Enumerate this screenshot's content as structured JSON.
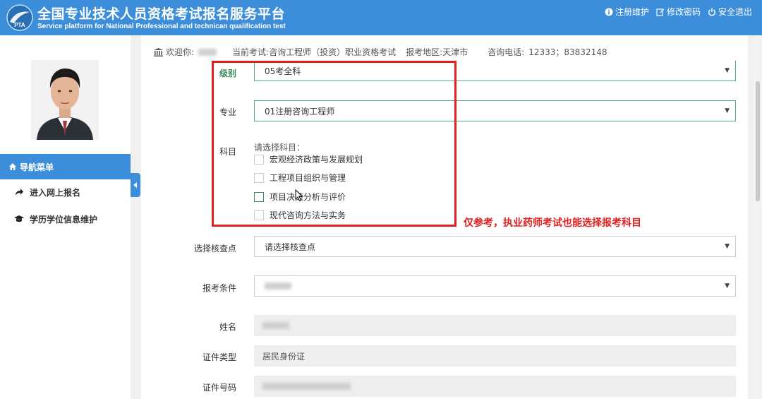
{
  "header": {
    "title": "全国专业技术人员资格考试报名服务平台",
    "subtitle": "Service platform for National Professional and technican qualification test",
    "logo_text": "PTA",
    "links": [
      "注册维护",
      "修改密码",
      "安全退出"
    ]
  },
  "sidebar": {
    "nav_title": "导航菜单",
    "items": [
      "进入网上报名",
      "学历学位信息维护"
    ]
  },
  "info_bar": {
    "welcome_label": "欢迎你:",
    "exam_label": "当前考试:",
    "exam_value": "咨询工程师（投资）职业资格考试",
    "region_label": "报考地区:",
    "region_value": "天津市",
    "phone_label": "咨询电话:",
    "phone_value": "12333；83832148"
  },
  "form": {
    "level": {
      "label": "级别",
      "value": "05考全科"
    },
    "major": {
      "label": "专业",
      "value": "01注册咨询工程师"
    },
    "subject": {
      "label": "科目",
      "prompt": "请选择科目：",
      "options": [
        "宏观经济政策与发展规划",
        "工程项目组织与管理",
        "项目决策分析与评价",
        "现代咨询方法与实务"
      ]
    },
    "checkpoint": {
      "label": "选择核查点",
      "value": "请选择核查点"
    },
    "condition": {
      "label": "报考条件"
    },
    "name": {
      "label": "姓名"
    },
    "id_type": {
      "label": "证件类型",
      "value": "居民身份证"
    },
    "id_number": {
      "label": "证件号码"
    }
  },
  "annotation": "仅参考，执业药师考试也能选择报考科目",
  "colors": {
    "header": "#3c8dda",
    "annotation": "#e02020",
    "focus_border": "#4cae7c"
  }
}
